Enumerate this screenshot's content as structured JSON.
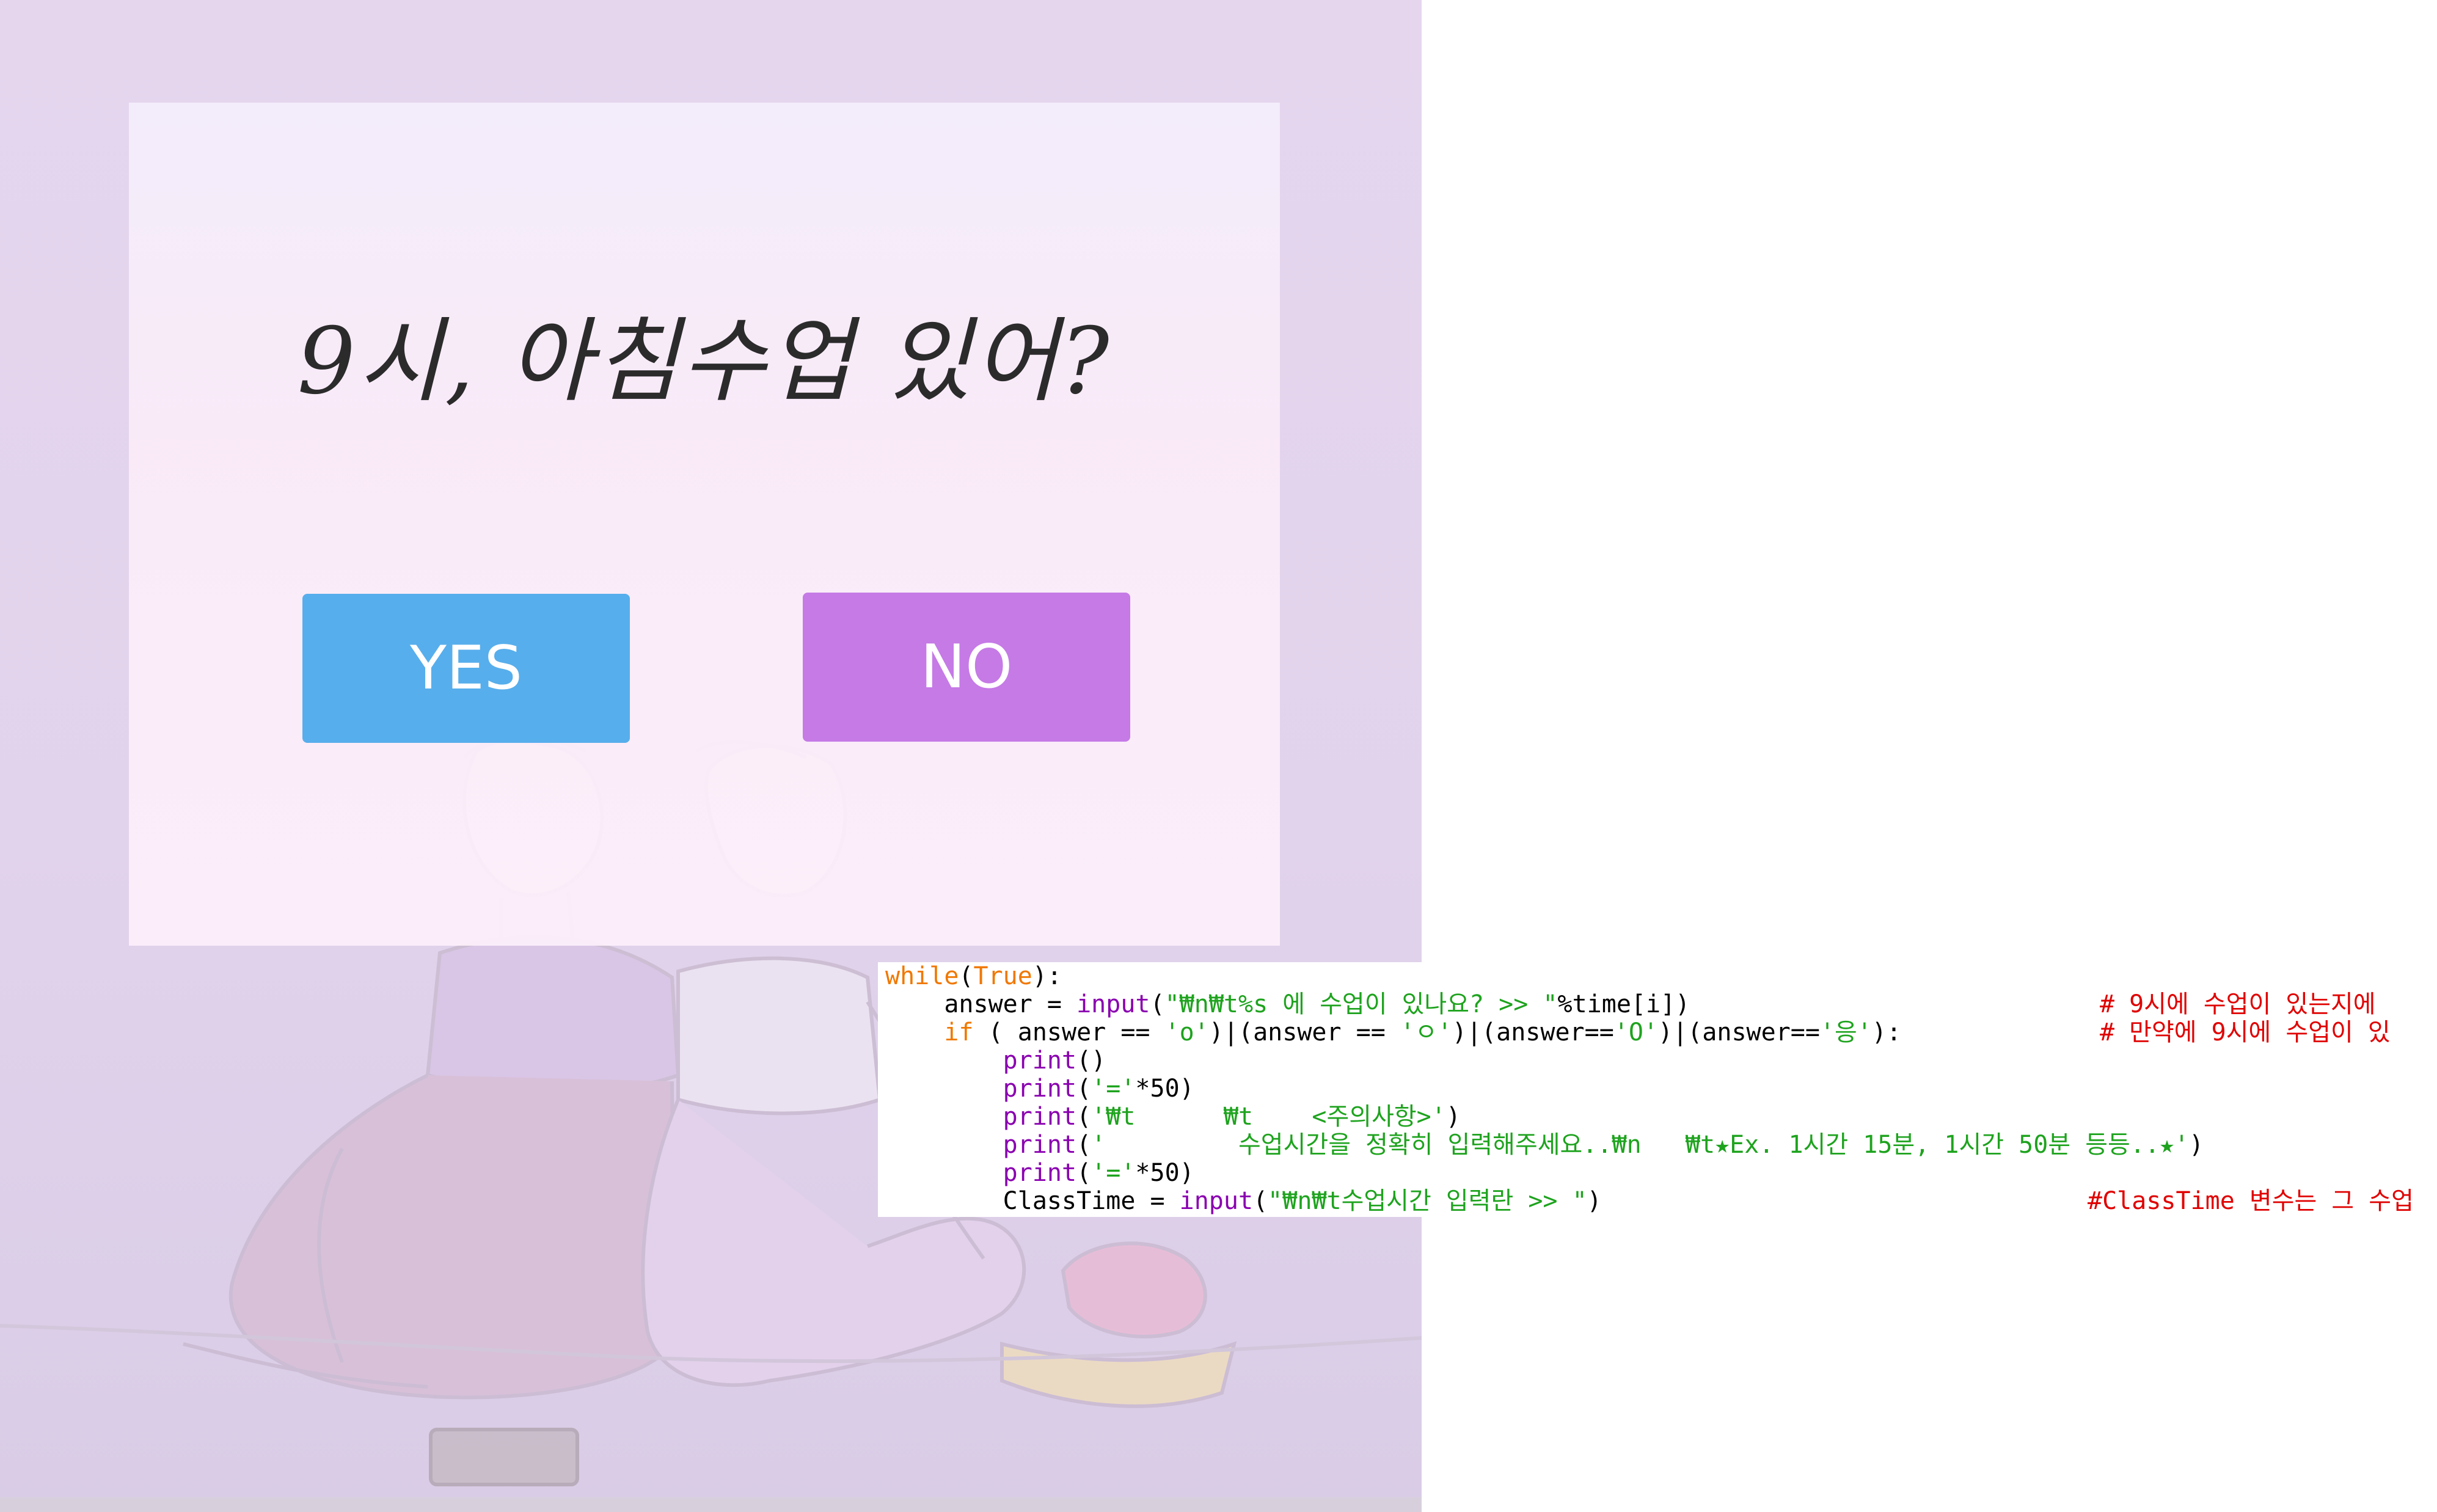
{
  "quiz": {
    "question": "9시, 아침수업 있어?",
    "yes_label": "YES",
    "no_label": "NO"
  },
  "code": {
    "lines": [
      "while(True):",
      "    answer = input(\"₩n₩t%s 에 수업이 있나요? >> \"%time[i])",
      "    if ( answer == 'o')|(answer == 'ㅇ')|(answer=='O')|(answer=='응'):",
      "        print()",
      "        print('='*50)",
      "        print('₩t      ₩t    <주의사항>')",
      "        print('         수업시간을 정확히 입력해주세요..₩n   ₩t★Ex. 1시간 15분, 1시간 50분 등등..★')",
      "        print('='*50)",
      "        ClassTime = input(\"₩n₩t수업시간 입력란 >> \")"
    ],
    "comments": [
      "# 9시에 수업이 있는지에",
      "# 만약에 9시에 수업이 있",
      "#ClassTime 변수는 그 수업"
    ]
  },
  "colors": {
    "yes_button": "#57aeec",
    "no_button": "#c57ae6",
    "background": "#e5d6ee",
    "keyword": "#f07800",
    "builtin": "#8a00b0",
    "string": "#1ea31e",
    "comment": "#e00000"
  }
}
